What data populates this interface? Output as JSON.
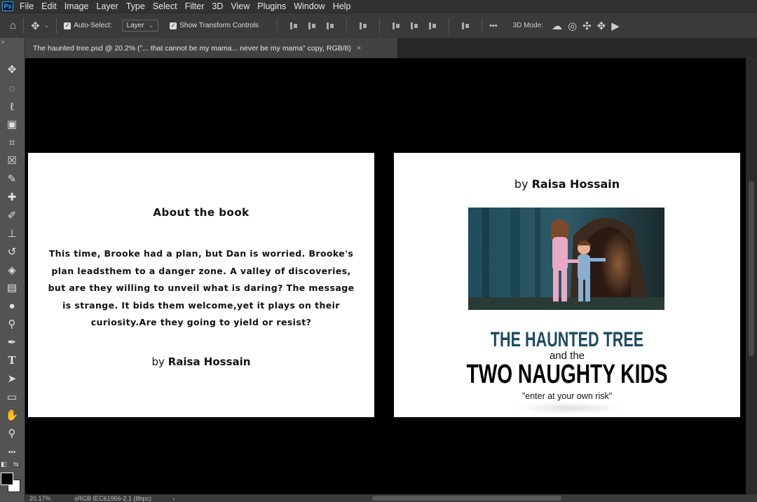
{
  "app": {
    "logo": "Ps"
  },
  "menu": [
    "File",
    "Edit",
    "Image",
    "Layer",
    "Type",
    "Select",
    "Filter",
    "3D",
    "View",
    "Plugins",
    "Window",
    "Help"
  ],
  "options": {
    "auto_select_label": "Auto-Select:",
    "auto_select_value": "Layer",
    "show_transform_label": "Show Transform Controls",
    "more_label": "•••",
    "mode_label": "3D Mode:"
  },
  "tab": {
    "title": "The haunted tree.psd @ 20.2% (\"... that cannot be my mama... never be my mama\" copy, RGB/8)",
    "close": "×"
  },
  "toolbar": {
    "tools": [
      {
        "name": "move-tool",
        "glyph": "✥"
      },
      {
        "name": "marquee-tool",
        "glyph": "◌"
      },
      {
        "name": "lasso-tool",
        "glyph": "ℓ"
      },
      {
        "name": "object-select-tool",
        "glyph": "▣"
      },
      {
        "name": "crop-tool",
        "glyph": "⌗"
      },
      {
        "name": "frame-tool",
        "glyph": "☒"
      },
      {
        "name": "eyedropper-tool",
        "glyph": "✎"
      },
      {
        "name": "healing-brush-tool",
        "glyph": "✚"
      },
      {
        "name": "brush-tool",
        "glyph": "✐"
      },
      {
        "name": "clone-stamp-tool",
        "glyph": "⊥"
      },
      {
        "name": "history-brush-tool",
        "glyph": "↺"
      },
      {
        "name": "eraser-tool",
        "glyph": "◈"
      },
      {
        "name": "gradient-tool",
        "glyph": "▤"
      },
      {
        "name": "blur-tool",
        "glyph": "●"
      },
      {
        "name": "dodge-tool",
        "glyph": "⚲"
      },
      {
        "name": "pen-tool",
        "glyph": "✒"
      },
      {
        "name": "type-tool",
        "glyph": "T"
      },
      {
        "name": "path-select-tool",
        "glyph": "➤"
      },
      {
        "name": "rectangle-tool",
        "glyph": "▭"
      },
      {
        "name": "hand-tool",
        "glyph": "✋"
      },
      {
        "name": "zoom-tool",
        "glyph": "⚲"
      },
      {
        "name": "more-tools",
        "glyph": "•••"
      }
    ]
  },
  "document": {
    "left_page": {
      "title": "About the book",
      "body": "This time, Brooke had a plan, but Dan is worried. Brooke's plan leadsthem to a danger zone. A valley of discoveries, but are they willing to unveil what is daring? The message is strange. It bids them welcome,yet it plays on their curiosity.Are they going to yield or resist?",
      "author_prefix": "by ",
      "author_name": "Raisa Hossain"
    },
    "right_page": {
      "author_prefix": "by ",
      "author_name": "Raisa Hossain",
      "title_line1": "THE HAUNTED TREE",
      "title_line2": "and the",
      "title_line3": "TWO NAUGHTY KIDS",
      "tagline": "\"enter at your own risk\""
    }
  },
  "status": {
    "zoom": "20.17%",
    "profile": "sRGB IEC61966-2.1 (8bpc)"
  },
  "colors": {
    "title_blue": "#1e4a63",
    "ui_dark": "#323232",
    "toolbar": "#535353"
  }
}
